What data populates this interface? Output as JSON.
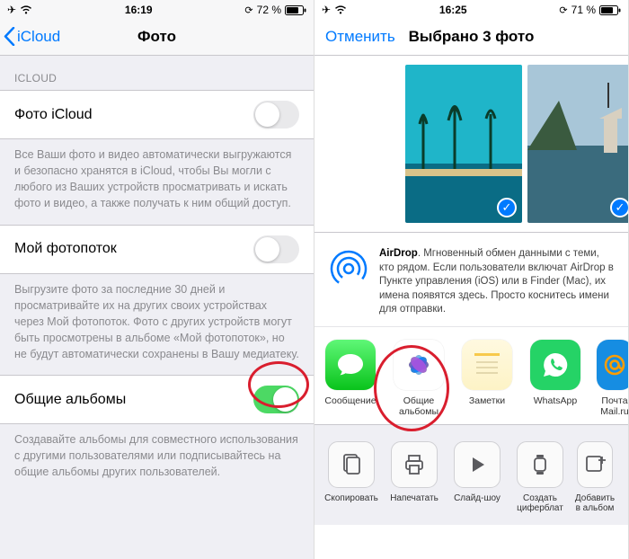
{
  "left": {
    "status": {
      "time": "16:19",
      "battery": "72 %"
    },
    "back": "iCloud",
    "title": "Фото",
    "section_header": "ICLOUD",
    "rows": {
      "icloud_photos": "Фото iCloud",
      "photostream": "Мой фотопоток",
      "shared_albums": "Общие альбомы"
    },
    "footers": {
      "icloud": "Все Ваши фото и видео автоматически выгружаются и безопасно хранятся в iCloud, чтобы Вы могли с любого из Ваших устройств просматривать и искать фото и видео, а также получать к ним общий доступ.",
      "photostream": "Выгрузите фото за последние 30 дней и просматривайте их на других своих устройствах через Мой фотопоток. Фото с других устройств могут быть просмотрены в альбоме «Мой фотопоток», но не будут автоматически сохранены в Вашу медиатеку.",
      "shared": "Создавайте альбомы для совместного использования с другими пользователями или подписывайтесь на общие альбомы других пользователей."
    }
  },
  "right": {
    "status": {
      "time": "16:25",
      "battery": "71 %"
    },
    "cancel": "Отменить",
    "title": "Выбрано 3 фото",
    "airdrop_title": "AirDrop",
    "airdrop_body": ". Мгновенный обмен данными с теми, кто рядом. Если пользователи включат AirDrop в Пункте управления (iOS) или в Finder (Mac), их имена появятся здесь. Просто коснитесь имени для отправки.",
    "share_apps": [
      {
        "name": "messages",
        "label": "Сообщение"
      },
      {
        "name": "shared-albums",
        "label": "Общие альбомы"
      },
      {
        "name": "notes",
        "label": "Заметки"
      },
      {
        "name": "whatsapp",
        "label": "WhatsApp"
      },
      {
        "name": "mailru",
        "label": "Почта Mail.ru"
      }
    ],
    "actions": [
      {
        "name": "copy",
        "label": "Скопировать"
      },
      {
        "name": "print",
        "label": "Напечатать"
      },
      {
        "name": "slideshow",
        "label": "Слайд-шоу"
      },
      {
        "name": "watchface",
        "label": "Создать циферблат"
      },
      {
        "name": "add-album",
        "label": "Добавить в альбом"
      }
    ]
  }
}
